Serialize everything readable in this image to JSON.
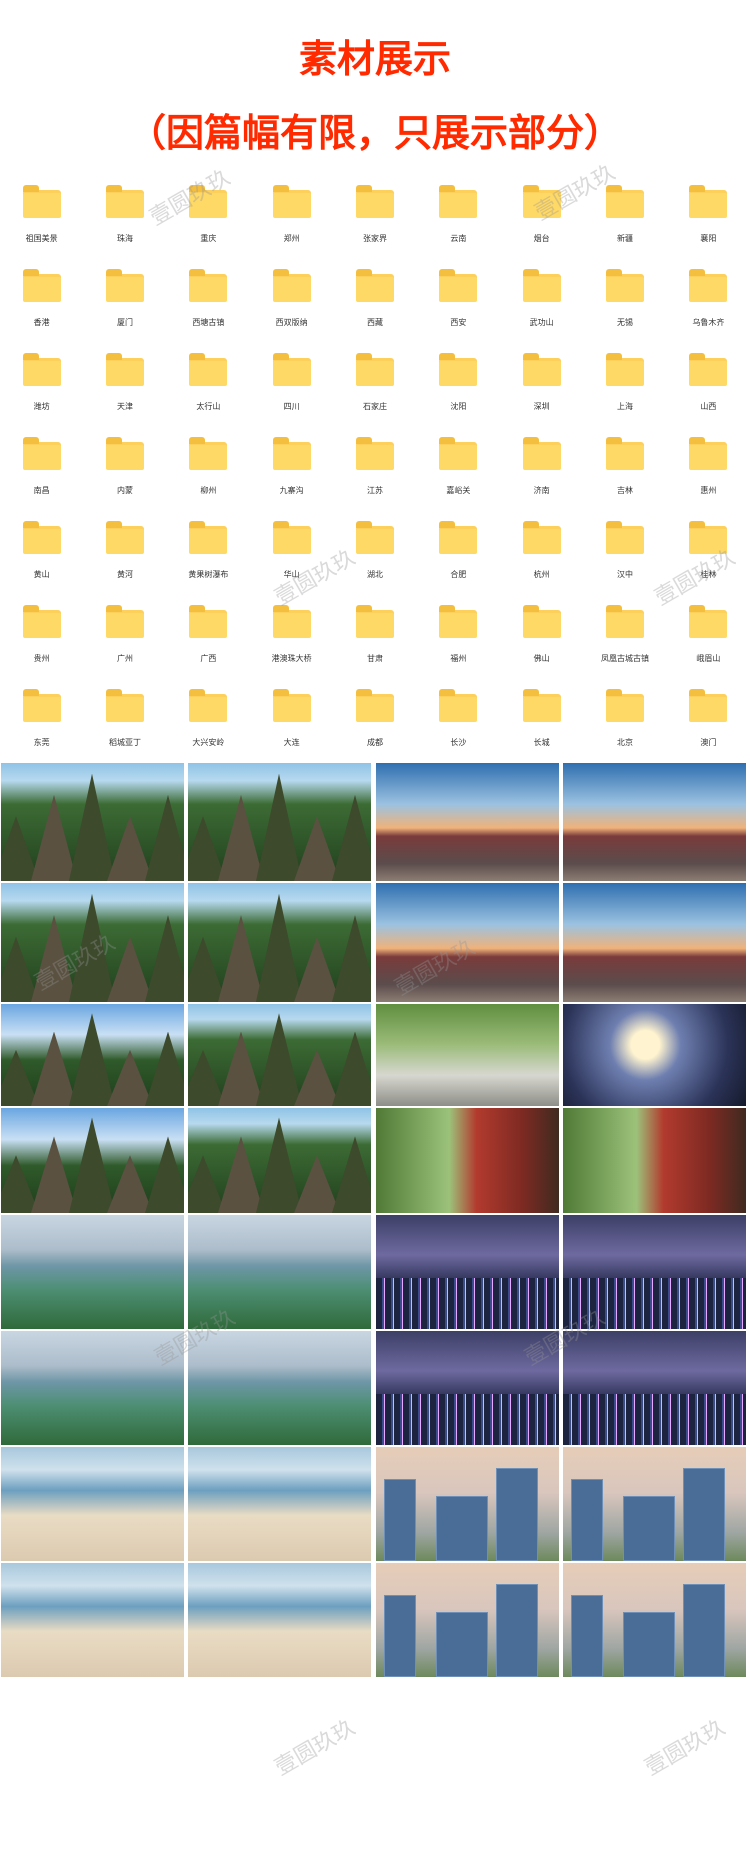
{
  "header": {
    "title": "素材展示",
    "subtitle": "（因篇幅有限，只展示部分）"
  },
  "watermark_text": "壹圆玖玖",
  "folders": [
    "祖国美景",
    "珠海",
    "重庆",
    "郑州",
    "张家界",
    "云南",
    "烟台",
    "新疆",
    "襄阳",
    "香港",
    "厦门",
    "西塘古镇",
    "西双版纳",
    "西藏",
    "西安",
    "武功山",
    "无锡",
    "乌鲁木齐",
    "潍坊",
    "天津",
    "太行山",
    "四川",
    "石家庄",
    "沈阳",
    "深圳",
    "上海",
    "山西",
    "南昌",
    "内蒙",
    "柳州",
    "九寨沟",
    "江苏",
    "嘉峪关",
    "济南",
    "吉林",
    "惠州",
    "黄山",
    "黄河",
    "黄果树瀑布",
    "华山",
    "湖北",
    "合肥",
    "杭州",
    "汉中",
    "桂林",
    "贵州",
    "广州",
    "广西",
    "港澳珠大桥",
    "甘肃",
    "福州",
    "佛山",
    "凤凰古城古镇",
    "峨眉山",
    "东莞",
    "稻城亚丁",
    "大兴安岭",
    "大连",
    "成都",
    "长沙",
    "长城",
    "北京",
    "澳门"
  ],
  "colors": {
    "title": "#ff2a00",
    "folder": "#ffd966"
  }
}
